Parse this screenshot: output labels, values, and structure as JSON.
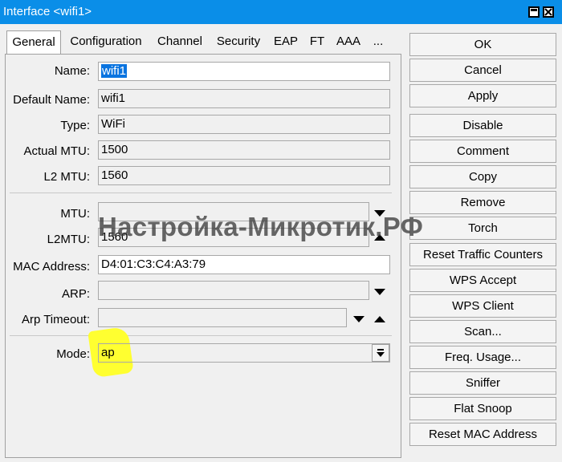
{
  "window": {
    "title": "Interface <wifi1>"
  },
  "tabs": [
    "General",
    "Configuration",
    "Channel",
    "Security",
    "EAP",
    "FT",
    "AAA",
    "..."
  ],
  "form": {
    "name": {
      "label": "Name:",
      "value": "wifi1"
    },
    "default_name": {
      "label": "Default Name:",
      "value": "wifi1"
    },
    "type": {
      "label": "Type:",
      "value": "WiFi"
    },
    "actual_mtu": {
      "label": "Actual MTU:",
      "value": "1500"
    },
    "l2_mtu": {
      "label": "L2 MTU:",
      "value": "1560"
    },
    "mtu": {
      "label": "MTU:",
      "value": ""
    },
    "l2mtu": {
      "label": "L2MTU:",
      "value": "1560"
    },
    "mac_address": {
      "label": "MAC Address:",
      "value": "D4:01:C3:C4:A3:79"
    },
    "arp": {
      "label": "ARP:",
      "value": ""
    },
    "arp_timeout": {
      "label": "Arp Timeout:",
      "value": ""
    },
    "mode": {
      "label": "Mode:",
      "value": "ap"
    }
  },
  "buttons": [
    "OK",
    "Cancel",
    "Apply",
    "Disable",
    "Comment",
    "Copy",
    "Remove",
    "Torch",
    "Reset Traffic Counters",
    "WPS Accept",
    "WPS Client",
    "Scan...",
    "Freq. Usage...",
    "Sniffer",
    "Flat Snoop",
    "Reset MAC Address"
  ],
  "watermark": "Настройка-Микротик.РФ"
}
